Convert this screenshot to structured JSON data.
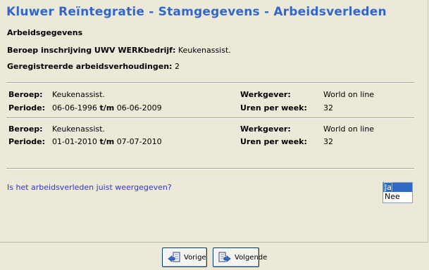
{
  "title": "Kluwer Reïntegratie - Stamgegevens - Arbeidsverleden",
  "section_heading": "Arbeidsgegevens",
  "beroep_uwv_label": "Beroep inschrijving UWV WERKbedrijf:",
  "beroep_uwv_value": "Keukenassist.",
  "arbeidsverhoudingen_label": "Geregistreerde arbeidsverhoudingen:",
  "arbeidsverhoudingen_value": "2",
  "records": [
    {
      "beroep_label": "Beroep:",
      "beroep": "Keukenassist.",
      "periode_label": "Periode:",
      "periode_start": "06-06-1996",
      "tm": "t/m",
      "periode_end": "06-06-2009",
      "werkgever_label": "Werkgever:",
      "werkgever": "World on line",
      "uren_label": "Uren per week:",
      "uren": "32"
    },
    {
      "beroep_label": "Beroep:",
      "beroep": "Keukenassist.",
      "periode_label": "Periode:",
      "periode_start": "01-01-2010",
      "tm": "t/m",
      "periode_end": "07-07-2010",
      "werkgever_label": "Werkgever:",
      "werkgever": "World on line",
      "uren_label": "Uren per week:",
      "uren": "32"
    }
  ],
  "question": "Is het arbeidsverleden juist weergegeven?",
  "answer_options": [
    "Ja",
    "Nee"
  ],
  "answer_selected": "Ja",
  "buttons": {
    "prev_label": "Vorige",
    "next_label": "Volgende"
  },
  "colors": {
    "title": "#3366cc",
    "question": "#3333cc",
    "selection": "#316ac5",
    "background": "#ece9d8"
  },
  "icons": {
    "prev": "arrow-left-doc-icon",
    "next": "arrow-right-doc-icon"
  }
}
